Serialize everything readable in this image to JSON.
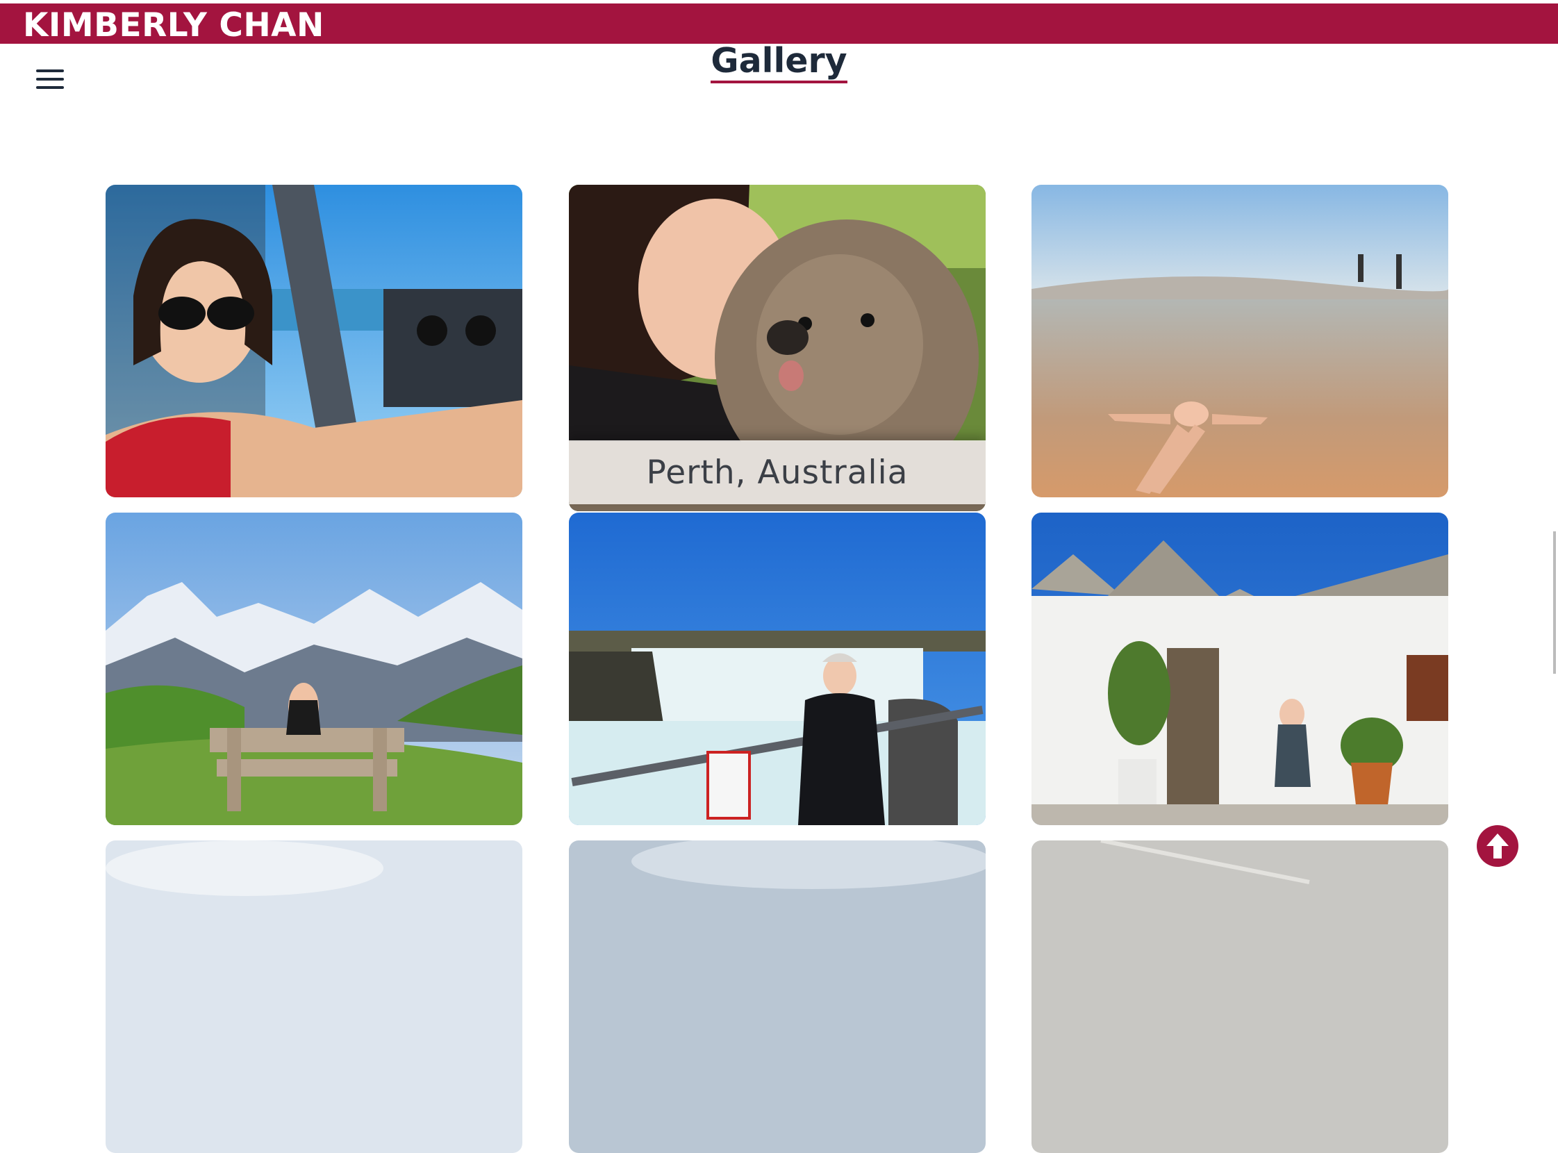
{
  "header": {
    "brand": "KIMBERLY CHAN"
  },
  "page": {
    "title": "Gallery"
  },
  "gallery": {
    "items": [
      {
        "id": "cockpit",
        "caption": ""
      },
      {
        "id": "quokka",
        "caption": "Perth, Australia"
      },
      {
        "id": "dead-sea",
        "caption": ""
      },
      {
        "id": "alps",
        "caption": ""
      },
      {
        "id": "waterfall",
        "caption": ""
      },
      {
        "id": "trulli",
        "caption": ""
      },
      {
        "id": "partial-1",
        "caption": ""
      },
      {
        "id": "partial-2",
        "caption": ""
      },
      {
        "id": "partial-3",
        "caption": ""
      }
    ]
  },
  "colors": {
    "accent": "#a3143f",
    "title": "#1e2a3a"
  },
  "icons": {
    "menu": "hamburger-menu-icon",
    "scroll_top": "arrow-up-circle-icon"
  }
}
